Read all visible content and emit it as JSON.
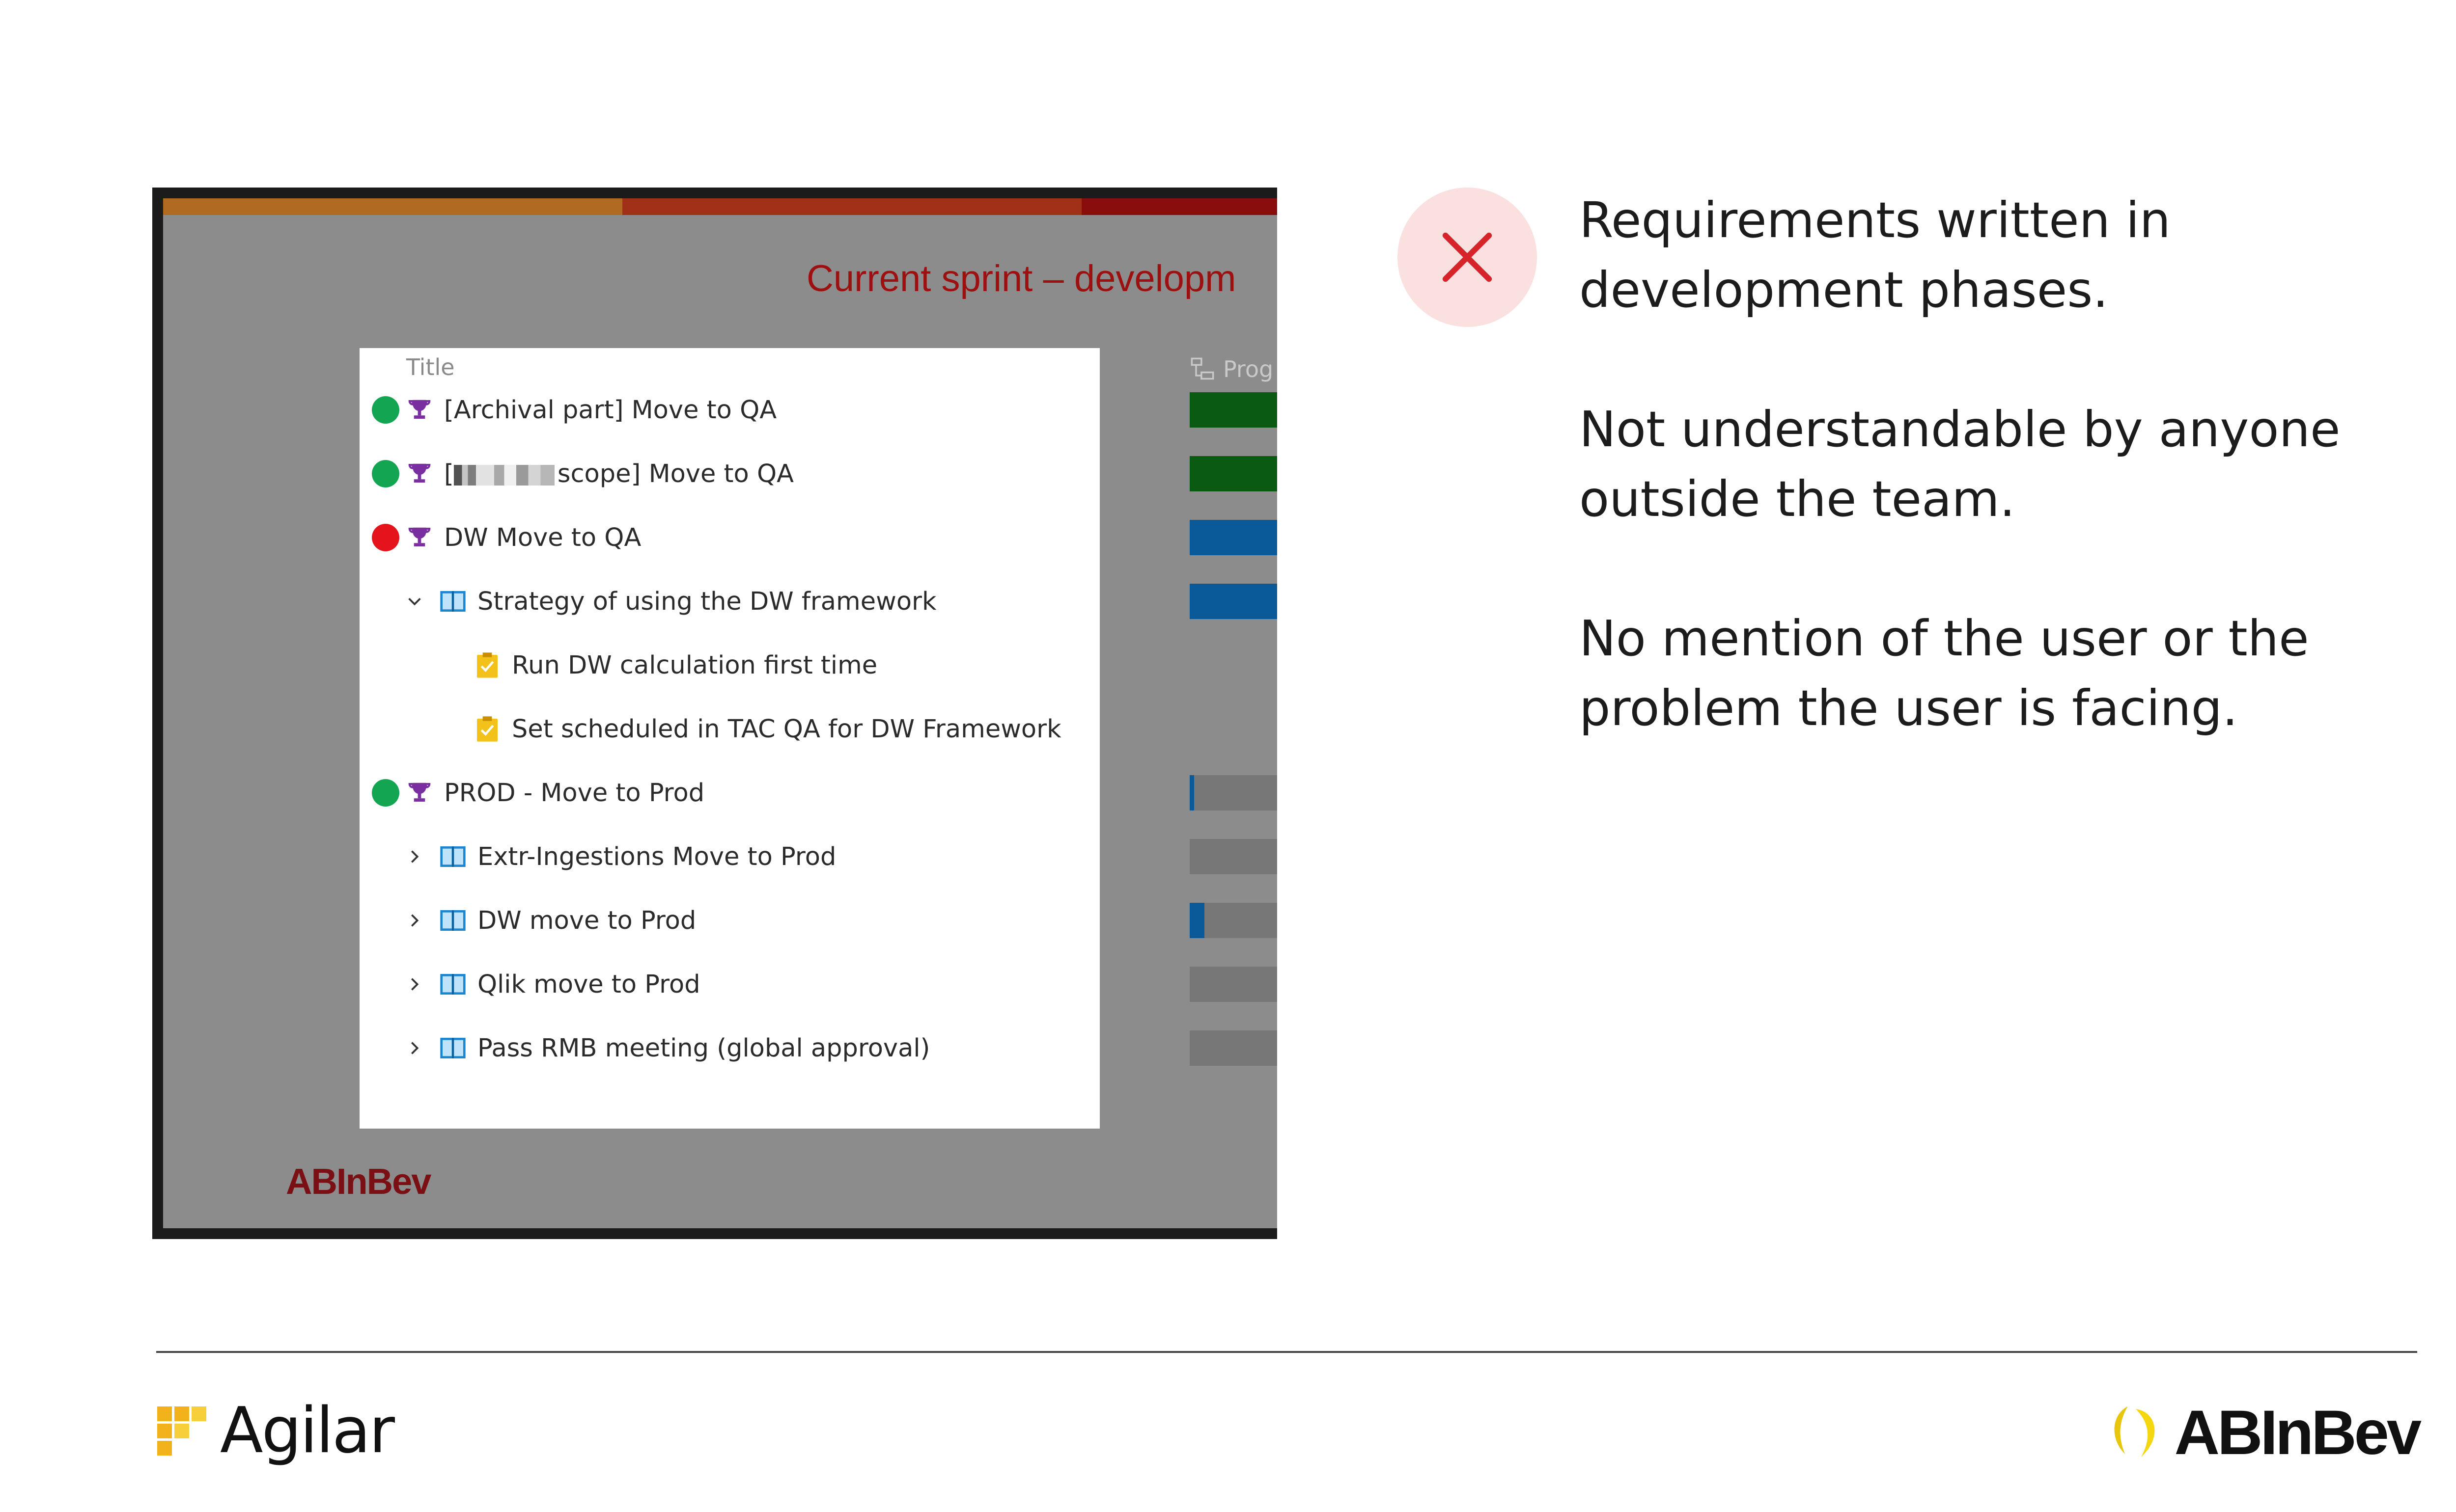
{
  "screenshot": {
    "slide_title": "Current sprint – developm",
    "column_title": "Title",
    "progress_header": "Prog",
    "inner_logo": "ABInBev",
    "rows": [
      {
        "text": "[Archival part] Move to QA",
        "status": "green",
        "icon": "trophy-icon"
      },
      {
        "text": "scope] Move to QA",
        "prefix": "[",
        "status": "green",
        "icon": "trophy-icon"
      },
      {
        "text": "DW Move to QA",
        "status": "red",
        "icon": "trophy-icon"
      },
      {
        "text": "Strategy of using the DW framework",
        "expander": "expanded",
        "icon": "book-icon"
      },
      {
        "text": "Run DW calculation first time",
        "icon": "task-clipboard-icon"
      },
      {
        "text": "Set scheduled in TAC QA for DW Framework",
        "icon": "task-clipboard-icon"
      },
      {
        "text": "PROD - Move to Prod",
        "status": "green",
        "icon": "trophy-icon"
      },
      {
        "text": "Extr-Ingestions Move to Prod",
        "expander": "collapsed",
        "icon": "book-icon"
      },
      {
        "text": "DW move to Prod",
        "expander": "collapsed",
        "icon": "book-icon"
      },
      {
        "text": "Qlik move to Prod",
        "expander": "collapsed",
        "icon": "book-icon"
      },
      {
        "text": "Pass RMB meeting (global approval)",
        "expander": "collapsed",
        "icon": "book-icon"
      }
    ],
    "progress": [
      {
        "row": 0,
        "fill": 1.0,
        "color": "#0b5a12"
      },
      {
        "row": 1,
        "fill": 1.0,
        "color": "#0b5a12"
      },
      {
        "row": 2,
        "fill": 1.0,
        "color": "#0a5a9a"
      },
      {
        "row": 3,
        "fill": 1.0,
        "color": "#0a5a9a"
      },
      {
        "row": 6,
        "fill": 0.05,
        "color": "#0a5a9a"
      },
      {
        "row": 7,
        "fill": 0.0,
        "color": "#0a5a9a"
      },
      {
        "row": 8,
        "fill": 0.17,
        "color": "#0a5a9a"
      },
      {
        "row": 9,
        "fill": 0.0,
        "color": "#0a5a9a"
      },
      {
        "row": 10,
        "fill": 0.0,
        "color": "#0a5a9a"
      }
    ],
    "status_colors": {
      "green": "#13a552",
      "red": "#e5131b"
    }
  },
  "points": [
    "Requirements written in development phases.",
    "Not understandable by anyone outside the team.",
    "No mention of the user or the problem the user is facing."
  ],
  "footer": {
    "left_logo": "Agilar",
    "right_logo": "ABInBev"
  }
}
